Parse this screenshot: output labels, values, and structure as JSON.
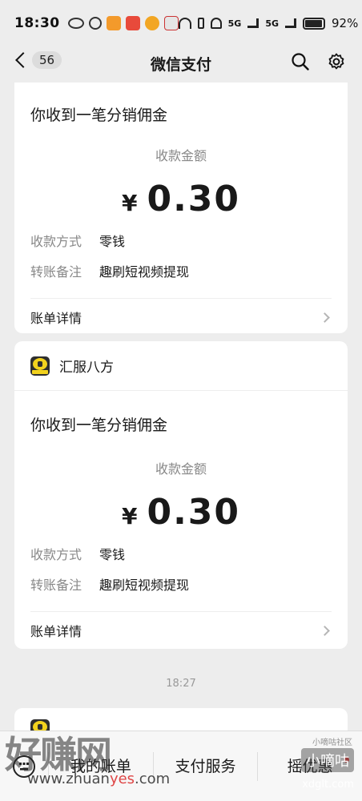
{
  "status_bar": {
    "time": "18:30",
    "network_1": "5G",
    "network_2": "5G",
    "battery": "92%"
  },
  "nav": {
    "unread_count": "56",
    "title": "微信支付"
  },
  "cards": [
    {
      "message_title": "你收到一笔分销佣金",
      "amount_label": "收款金额",
      "currency": "¥",
      "amount": "0.30",
      "method_key": "收款方式",
      "method_value": "零钱",
      "note_key": "转账备注",
      "note_value": "趣刷短视频提现",
      "detail_label": "账单详情"
    },
    {
      "app_name": "汇服八方",
      "message_title": "你收到一笔分销佣金",
      "amount_label": "收款金额",
      "currency": "¥",
      "amount": "0.30",
      "method_key": "收款方式",
      "method_value": "零钱",
      "note_key": "转账备注",
      "note_value": "趣刷短视频提现",
      "detail_label": "账单详情"
    }
  ],
  "timestamp": "18:27",
  "menu": {
    "item_1": "我的账单",
    "item_2": "支付服务",
    "item_3": "摇优惠"
  },
  "watermarks": {
    "logo": "好赚网",
    "url_part1": "www.zhuan",
    "url_part2": "yes",
    "url_part3": ".com",
    "right_text": "小嘀咕",
    "right_sub": "xdglt.com",
    "tiny": "小嘀咕社区"
  },
  "colors": {
    "background": "#ededed",
    "card": "#ffffff",
    "accent_red": "#e64340",
    "logo_yellow": "#f2d21d"
  }
}
